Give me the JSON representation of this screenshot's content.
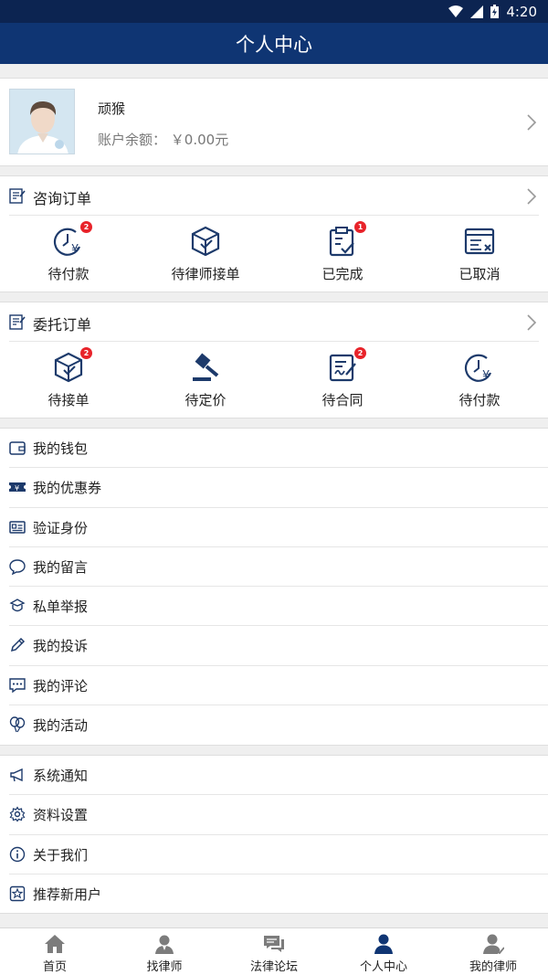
{
  "status_bar": {
    "time": "4:20"
  },
  "header": {
    "title": "个人中心"
  },
  "profile": {
    "name": "顽猴",
    "balance_label": "账户余额：",
    "balance_value": "￥0.00元"
  },
  "consult_orders": {
    "title": "咨询订单",
    "items": [
      {
        "label": "待付款",
        "icon": "clock-yen-icon",
        "badge": "2"
      },
      {
        "label": "待律师接单",
        "icon": "box-check-icon",
        "badge": ""
      },
      {
        "label": "已完成",
        "icon": "clipboard-check-icon",
        "badge": "1"
      },
      {
        "label": "已取消",
        "icon": "window-cancel-icon",
        "badge": ""
      }
    ]
  },
  "entrust_orders": {
    "title": "委托订单",
    "items": [
      {
        "label": "待接单",
        "icon": "box-check-icon",
        "badge": "2"
      },
      {
        "label": "待定价",
        "icon": "gavel-icon",
        "badge": ""
      },
      {
        "label": "待合同",
        "icon": "contract-sign-icon",
        "badge": "2"
      },
      {
        "label": "待付款",
        "icon": "clock-yen-icon",
        "badge": ""
      }
    ]
  },
  "menu_group1": [
    {
      "label": "我的钱包",
      "icon": "wallet-icon"
    },
    {
      "label": "我的优惠券",
      "icon": "ticket-icon"
    },
    {
      "label": "验证身份",
      "icon": "id-card-icon"
    },
    {
      "label": "我的留言",
      "icon": "chat-bubble-icon"
    },
    {
      "label": "私单举报",
      "icon": "report-icon"
    },
    {
      "label": "我的投诉",
      "icon": "pencil-icon"
    },
    {
      "label": "我的评论",
      "icon": "comment-dots-icon"
    },
    {
      "label": "我的活动",
      "icon": "balloons-icon"
    }
  ],
  "menu_group2": [
    {
      "label": "系统通知",
      "icon": "megaphone-icon"
    },
    {
      "label": "资料设置",
      "icon": "gear-icon"
    },
    {
      "label": "关于我们",
      "icon": "info-icon"
    },
    {
      "label": "推荐新用户",
      "icon": "star-badge-icon"
    }
  ],
  "bottom_nav": [
    {
      "label": "首页",
      "icon": "home-icon"
    },
    {
      "label": "找律师",
      "icon": "lawyer-search-icon"
    },
    {
      "label": "法律论坛",
      "icon": "forum-icon"
    },
    {
      "label": "个人中心",
      "icon": "person-icon"
    },
    {
      "label": "我的律师",
      "icon": "my-lawyer-icon"
    }
  ],
  "colors": {
    "header": "#0f3573",
    "status_bar": "#0c2451",
    "icon": "#1d3a6b",
    "badge": "#e8232a"
  }
}
